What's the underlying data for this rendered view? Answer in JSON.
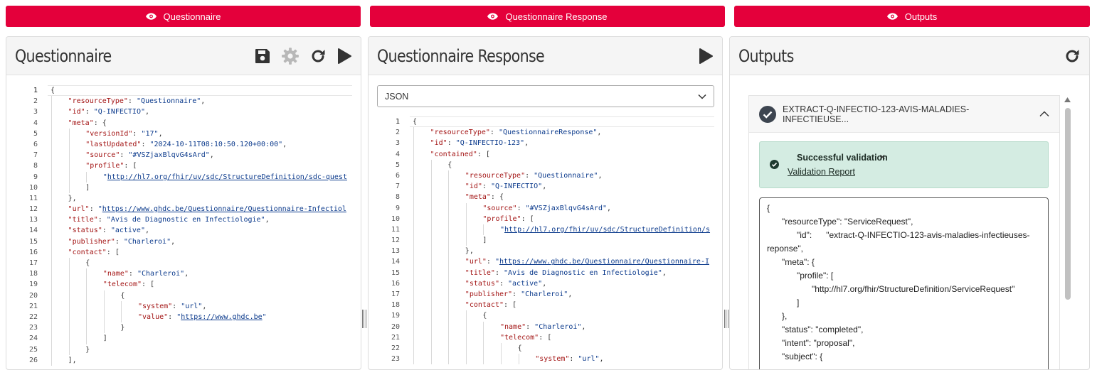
{
  "tabs": [
    {
      "label": "Questionnaire"
    },
    {
      "label": "Questionnaire Response"
    },
    {
      "label": "Outputs"
    }
  ],
  "colors": {
    "accent": "#e4003b",
    "success_bg": "#d4ece2"
  },
  "questionnaire": {
    "title": "Questionnaire",
    "icons": [
      "save-icon",
      "gear-icon",
      "refresh-icon",
      "play-icon"
    ]
  },
  "response": {
    "title": "Questionnaire Response",
    "format_selected": "JSON",
    "icons": [
      "play-icon"
    ]
  },
  "outputs": {
    "title": "Outputs",
    "icons": [
      "refresh-icon"
    ],
    "item_title": "EXTRACT-Q-INFECTIO-123-AVIS-MALADIES-INFECTIEUSE...",
    "validation_title": "Successful validation",
    "validation_close": "×",
    "validation_link": "Validation Report",
    "json_lines": [
      {
        "i": 0,
        "t": "{"
      },
      {
        "i": 1,
        "t": "\"resourceType\": \"ServiceRequest\","
      },
      {
        "i": 2,
        "t": "\"id\":      \"extract-Q-INFECTIO-123-avis-maladies-infectieuses-"
      },
      {
        "i": 0,
        "t": "reponse\","
      },
      {
        "i": 1,
        "t": "\"meta\": {"
      },
      {
        "i": 2,
        "t": "\"profile\": ["
      },
      {
        "i": 3,
        "t": "\"http://hl7.org/fhir/StructureDefinition/ServiceRequest\""
      },
      {
        "i": 2,
        "t": "]"
      },
      {
        "i": 1,
        "t": "},"
      },
      {
        "i": 1,
        "t": "\"status\": \"completed\","
      },
      {
        "i": 1,
        "t": "\"intent\": \"proposal\","
      },
      {
        "i": 1,
        "t": "\"subject\": {"
      }
    ]
  },
  "q_code": [
    {
      "n": "1",
      "i": 0,
      "s": [
        [
          "p",
          "{"
        ]
      ]
    },
    {
      "n": "2",
      "i": 1,
      "s": [
        [
          "k",
          "\"resourceType\""
        ],
        [
          "p",
          ": "
        ],
        [
          "s",
          "\"Questionnaire\""
        ],
        [
          "p",
          ","
        ]
      ]
    },
    {
      "n": "3",
      "i": 1,
      "s": [
        [
          "k",
          "\"id\""
        ],
        [
          "p",
          ": "
        ],
        [
          "s",
          "\"Q-INFECTIO\""
        ],
        [
          "p",
          ","
        ]
      ]
    },
    {
      "n": "4",
      "i": 1,
      "s": [
        [
          "k",
          "\"meta\""
        ],
        [
          "p",
          ": {"
        ]
      ]
    },
    {
      "n": "5",
      "i": 2,
      "s": [
        [
          "k",
          "\"versionId\""
        ],
        [
          "p",
          ": "
        ],
        [
          "s",
          "\"17\""
        ],
        [
          "p",
          ","
        ]
      ]
    },
    {
      "n": "6",
      "i": 2,
      "s": [
        [
          "k",
          "\"lastUpdated\""
        ],
        [
          "p",
          ": "
        ],
        [
          "s",
          "\"2024-10-11T08:10:50.120+00:00\""
        ],
        [
          "p",
          ","
        ]
      ]
    },
    {
      "n": "7",
      "i": 2,
      "s": [
        [
          "k",
          "\"source\""
        ],
        [
          "p",
          ": "
        ],
        [
          "s",
          "\"#VSZjaxBlqvG4sArd\""
        ],
        [
          "p",
          ","
        ]
      ]
    },
    {
      "n": "8",
      "i": 2,
      "s": [
        [
          "k",
          "\"profile\""
        ],
        [
          "p",
          ": ["
        ]
      ]
    },
    {
      "n": "9",
      "i": 3,
      "s": [
        [
          "s",
          "\""
        ],
        [
          "u",
          "http://hl7.org/fhir/uv/sdc/StructureDefinition/sdc-quest"
        ]
      ]
    },
    {
      "n": "10",
      "i": 2,
      "s": [
        [
          "p",
          "]"
        ]
      ]
    },
    {
      "n": "11",
      "i": 1,
      "s": [
        [
          "p",
          "},"
        ]
      ]
    },
    {
      "n": "12",
      "i": 1,
      "s": [
        [
          "k",
          "\"url\""
        ],
        [
          "p",
          ": "
        ],
        [
          "s",
          "\""
        ],
        [
          "u",
          "https://www.ghdc.be/Questionnaire/Questionnaire-Infectiol"
        ]
      ]
    },
    {
      "n": "13",
      "i": 1,
      "s": [
        [
          "k",
          "\"title\""
        ],
        [
          "p",
          ": "
        ],
        [
          "s",
          "\"Avis de Diagnostic en Infectiologie\""
        ],
        [
          "p",
          ","
        ]
      ]
    },
    {
      "n": "14",
      "i": 1,
      "s": [
        [
          "k",
          "\"status\""
        ],
        [
          "p",
          ": "
        ],
        [
          "s",
          "\"active\""
        ],
        [
          "p",
          ","
        ]
      ]
    },
    {
      "n": "15",
      "i": 1,
      "s": [
        [
          "k",
          "\"publisher\""
        ],
        [
          "p",
          ": "
        ],
        [
          "s",
          "\"Charleroi\""
        ],
        [
          "p",
          ","
        ]
      ]
    },
    {
      "n": "16",
      "i": 1,
      "s": [
        [
          "k",
          "\"contact\""
        ],
        [
          "p",
          ": ["
        ]
      ]
    },
    {
      "n": "17",
      "i": 2,
      "s": [
        [
          "p",
          "{"
        ]
      ]
    },
    {
      "n": "18",
      "i": 3,
      "s": [
        [
          "k",
          "\"name\""
        ],
        [
          "p",
          ": "
        ],
        [
          "s",
          "\"Charleroi\""
        ],
        [
          "p",
          ","
        ]
      ]
    },
    {
      "n": "19",
      "i": 3,
      "s": [
        [
          "k",
          "\"telecom\""
        ],
        [
          "p",
          ": ["
        ]
      ]
    },
    {
      "n": "20",
      "i": 4,
      "s": [
        [
          "p",
          "{"
        ]
      ]
    },
    {
      "n": "21",
      "i": 5,
      "s": [
        [
          "k",
          "\"system\""
        ],
        [
          "p",
          ": "
        ],
        [
          "s",
          "\"url\""
        ],
        [
          "p",
          ","
        ]
      ]
    },
    {
      "n": "22",
      "i": 5,
      "s": [
        [
          "k",
          "\"value\""
        ],
        [
          "p",
          ": "
        ],
        [
          "s",
          "\""
        ],
        [
          "u",
          "https://www.ghdc.be"
        ],
        [
          "s",
          "\""
        ]
      ]
    },
    {
      "n": "23",
      "i": 4,
      "s": [
        [
          "p",
          "}"
        ]
      ]
    },
    {
      "n": "24",
      "i": 3,
      "s": [
        [
          "p",
          "]"
        ]
      ]
    },
    {
      "n": "25",
      "i": 2,
      "s": [
        [
          "p",
          "}"
        ]
      ]
    },
    {
      "n": "26",
      "i": 1,
      "s": [
        [
          "p",
          "],"
        ]
      ]
    }
  ],
  "r_code": [
    {
      "n": "1",
      "i": 0,
      "s": [
        [
          "p",
          "{"
        ]
      ]
    },
    {
      "n": "2",
      "i": 1,
      "s": [
        [
          "k",
          "\"resourceType\""
        ],
        [
          "p",
          ": "
        ],
        [
          "s",
          "\"QuestionnaireResponse\""
        ],
        [
          "p",
          ","
        ]
      ]
    },
    {
      "n": "3",
      "i": 1,
      "s": [
        [
          "k",
          "\"id\""
        ],
        [
          "p",
          ": "
        ],
        [
          "s",
          "\"Q-INFECTIO-123\""
        ],
        [
          "p",
          ","
        ]
      ]
    },
    {
      "n": "4",
      "i": 1,
      "s": [
        [
          "k",
          "\"contained\""
        ],
        [
          "p",
          ": ["
        ]
      ]
    },
    {
      "n": "5",
      "i": 2,
      "s": [
        [
          "p",
          "{"
        ]
      ]
    },
    {
      "n": "6",
      "i": 3,
      "s": [
        [
          "k",
          "\"resourceType\""
        ],
        [
          "p",
          ": "
        ],
        [
          "s",
          "\"Questionnaire\""
        ],
        [
          "p",
          ","
        ]
      ]
    },
    {
      "n": "7",
      "i": 3,
      "s": [
        [
          "k",
          "\"id\""
        ],
        [
          "p",
          ": "
        ],
        [
          "s",
          "\"Q-INFECTIO\""
        ],
        [
          "p",
          ","
        ]
      ]
    },
    {
      "n": "8",
      "i": 3,
      "s": [
        [
          "k",
          "\"meta\""
        ],
        [
          "p",
          ": {"
        ]
      ]
    },
    {
      "n": "9",
      "i": 4,
      "s": [
        [
          "k",
          "\"source\""
        ],
        [
          "p",
          ": "
        ],
        [
          "s",
          "\"#VSZjaxBlqvG4sArd\""
        ],
        [
          "p",
          ","
        ]
      ]
    },
    {
      "n": "10",
      "i": 4,
      "s": [
        [
          "k",
          "\"profile\""
        ],
        [
          "p",
          ": ["
        ]
      ]
    },
    {
      "n": "11",
      "i": 5,
      "s": [
        [
          "s",
          "\""
        ],
        [
          "u",
          "http://hl7.org/fhir/uv/sdc/StructureDefinition/s"
        ]
      ]
    },
    {
      "n": "12",
      "i": 4,
      "s": [
        [
          "p",
          "]"
        ]
      ]
    },
    {
      "n": "13",
      "i": 3,
      "s": [
        [
          "p",
          "},"
        ]
      ]
    },
    {
      "n": "14",
      "i": 3,
      "s": [
        [
          "k",
          "\"url\""
        ],
        [
          "p",
          ": "
        ],
        [
          "s",
          "\""
        ],
        [
          "u",
          "https://www.ghdc.be/Questionnaire/Questionnaire-I"
        ]
      ]
    },
    {
      "n": "15",
      "i": 3,
      "s": [
        [
          "k",
          "\"title\""
        ],
        [
          "p",
          ": "
        ],
        [
          "s",
          "\"Avis de Diagnostic en Infectiologie\""
        ],
        [
          "p",
          ","
        ]
      ]
    },
    {
      "n": "16",
      "i": 3,
      "s": [
        [
          "k",
          "\"status\""
        ],
        [
          "p",
          ": "
        ],
        [
          "s",
          "\"active\""
        ],
        [
          "p",
          ","
        ]
      ]
    },
    {
      "n": "17",
      "i": 3,
      "s": [
        [
          "k",
          "\"publisher\""
        ],
        [
          "p",
          ": "
        ],
        [
          "s",
          "\"Charleroi\""
        ],
        [
          "p",
          ","
        ]
      ]
    },
    {
      "n": "18",
      "i": 3,
      "s": [
        [
          "k",
          "\"contact\""
        ],
        [
          "p",
          ": ["
        ]
      ]
    },
    {
      "n": "19",
      "i": 4,
      "s": [
        [
          "p",
          "{"
        ]
      ]
    },
    {
      "n": "20",
      "i": 5,
      "s": [
        [
          "k",
          "\"name\""
        ],
        [
          "p",
          ": "
        ],
        [
          "s",
          "\"Charleroi\""
        ],
        [
          "p",
          ","
        ]
      ]
    },
    {
      "n": "21",
      "i": 5,
      "s": [
        [
          "k",
          "\"telecom\""
        ],
        [
          "p",
          ": ["
        ]
      ]
    },
    {
      "n": "22",
      "i": 6,
      "s": [
        [
          "p",
          "{"
        ]
      ]
    },
    {
      "n": "23",
      "i": 7,
      "s": [
        [
          "k",
          "\"system\""
        ],
        [
          "p",
          ": "
        ],
        [
          "s",
          "\"url\""
        ],
        [
          "p",
          ","
        ]
      ]
    }
  ]
}
